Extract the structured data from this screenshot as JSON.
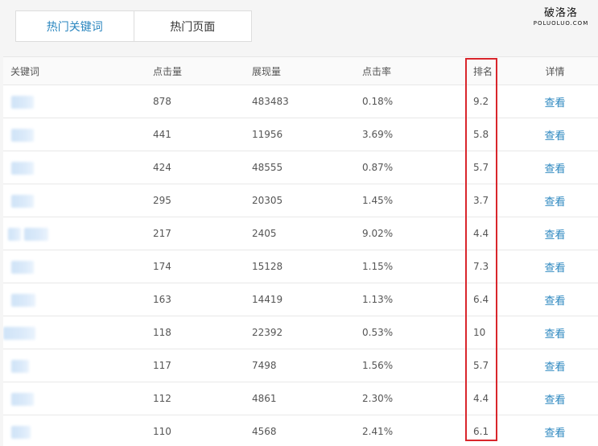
{
  "tabs": [
    {
      "label": "热门关键词",
      "active": true
    },
    {
      "label": "热门页面",
      "active": false
    }
  ],
  "watermark": {
    "cn": "破洛洛",
    "en": "POLUOLUO.COM"
  },
  "table": {
    "headers": {
      "keyword": "关键词",
      "clicks": "点击量",
      "impressions": "展现量",
      "ctr": "点击率",
      "rank": "排名",
      "detail": "详情"
    },
    "rows": [
      {
        "clicks": "878",
        "impressions": "483483",
        "ctr": "0.18%",
        "rank": "9.2",
        "detail": "查看"
      },
      {
        "clicks": "441",
        "impressions": "11956",
        "ctr": "3.69%",
        "rank": "5.8",
        "detail": "查看"
      },
      {
        "clicks": "424",
        "impressions": "48555",
        "ctr": "0.87%",
        "rank": "5.7",
        "detail": "查看"
      },
      {
        "clicks": "295",
        "impressions": "20305",
        "ctr": "1.45%",
        "rank": "3.7",
        "detail": "查看"
      },
      {
        "clicks": "217",
        "impressions": "2405",
        "ctr": "9.02%",
        "rank": "4.4",
        "detail": "查看"
      },
      {
        "clicks": "174",
        "impressions": "15128",
        "ctr": "1.15%",
        "rank": "7.3",
        "detail": "查看"
      },
      {
        "clicks": "163",
        "impressions": "14419",
        "ctr": "1.13%",
        "rank": "6.4",
        "detail": "查看"
      },
      {
        "clicks": "118",
        "impressions": "22392",
        "ctr": "0.53%",
        "rank": "10",
        "detail": "查看"
      },
      {
        "clicks": "117",
        "impressions": "7498",
        "ctr": "1.56%",
        "rank": "5.7",
        "detail": "查看"
      },
      {
        "clicks": "112",
        "impressions": "4861",
        "ctr": "2.30%",
        "rank": "4.4",
        "detail": "查看"
      },
      {
        "clicks": "110",
        "impressions": "4568",
        "ctr": "2.41%",
        "rank": "6.1",
        "detail": "查看"
      }
    ]
  },
  "colors": {
    "accent": "#2a86bf",
    "highlight": "#d9262c"
  }
}
